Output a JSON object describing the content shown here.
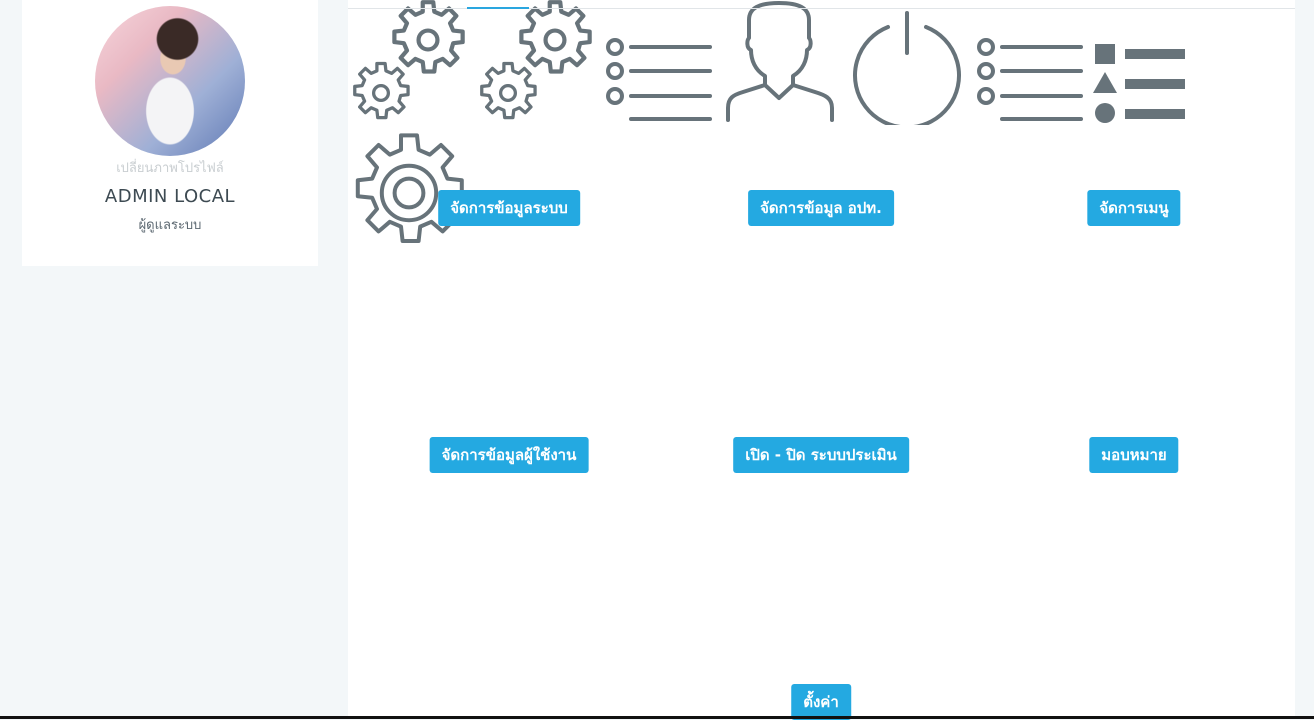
{
  "profile": {
    "change_photo": "เปลี่ยนภาพโปรไฟล์",
    "name": "ADMIN LOCAL",
    "role": "ผู้ดูแลระบบ"
  },
  "colors": {
    "accent": "#24a9e1",
    "icon": "#67737a",
    "sidebar_bg": "#f3f7f9"
  },
  "tiles": [
    {
      "icon": "gears-icon",
      "label": "จัดการข้อมูลระบบ"
    },
    {
      "icon": "gears-icon",
      "label": "จัดการข้อมูล อปท."
    },
    {
      "icon": "list-icon",
      "label": "จัดการเมนู"
    },
    {
      "icon": "user-icon",
      "label": "จัดการข้อมูลผู้ใช้งาน"
    },
    {
      "icon": "power-icon",
      "label": "เปิด - ปิด ระบบประเมิน"
    },
    {
      "icon": "list-icon",
      "label": "มอบหมาย"
    },
    {
      "icon": "shapes-list-icon",
      "label": ""
    },
    {
      "icon": "gear-icon",
      "label": "ตั้งค่า"
    }
  ]
}
